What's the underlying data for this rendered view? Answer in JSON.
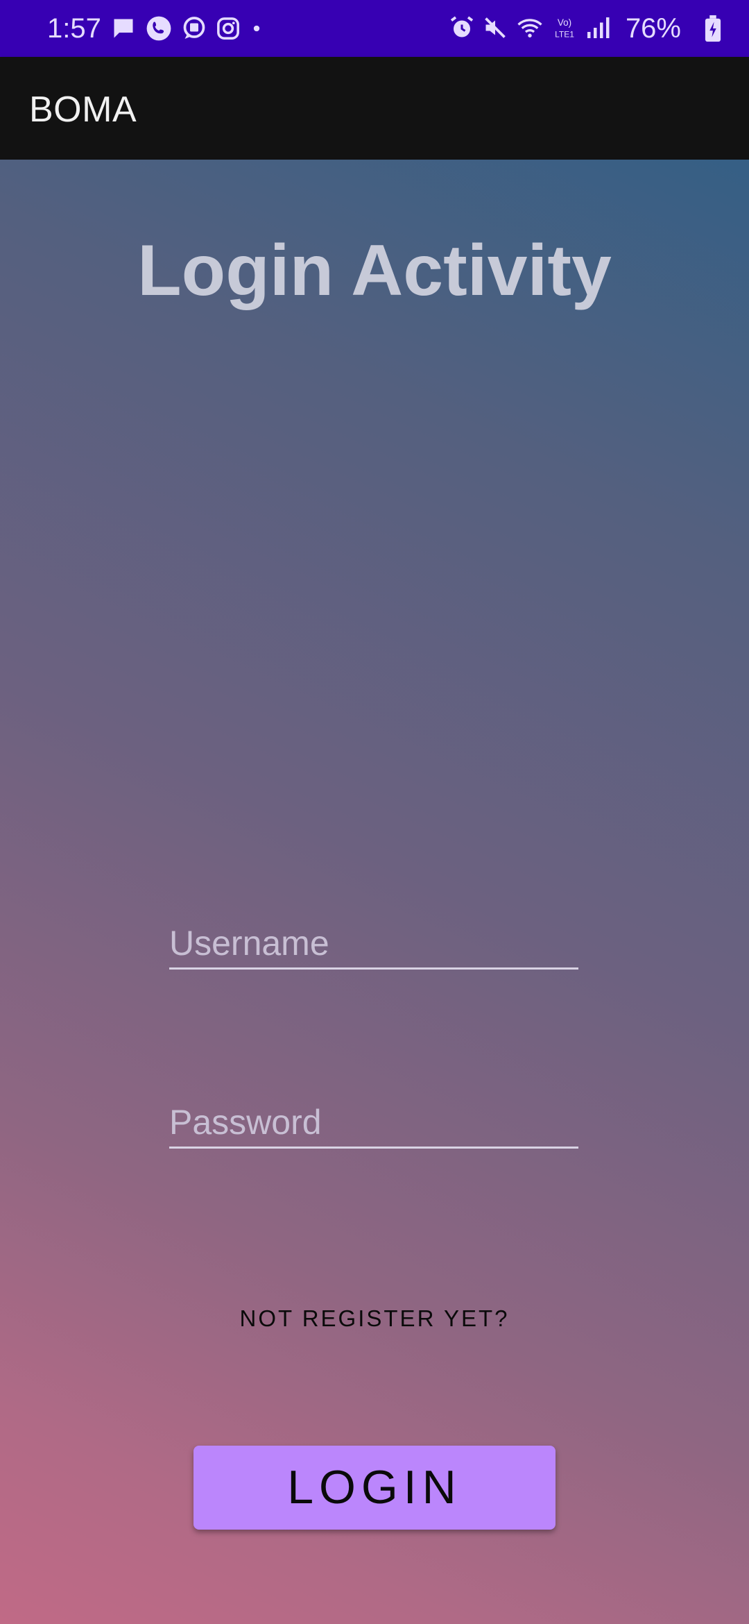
{
  "status_bar": {
    "time": "1:57",
    "battery_percent": "76%",
    "network_label": "Vo) LTE1",
    "left_icons": [
      "message-icon",
      "phone-icon",
      "chat-icon",
      "instagram-icon",
      "dot-icon"
    ],
    "right_icons": [
      "alarm-icon",
      "mute-icon",
      "wifi-icon",
      "lte-icon",
      "signal-icon"
    ],
    "background_color": "#3700b3"
  },
  "app_bar": {
    "title": "BOMA",
    "background_color": "#121212"
  },
  "login": {
    "heading": "Login Activity",
    "username_placeholder": "Username",
    "password_placeholder": "Password",
    "register_link": "NOT REGISTER YET?",
    "login_button": "LOGIN",
    "button_color": "#bb86fc"
  }
}
